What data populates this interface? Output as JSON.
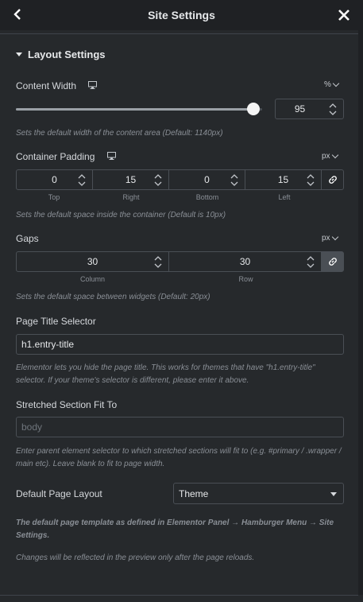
{
  "header": {
    "title": "Site Settings",
    "back_icon": "chevron-left-icon",
    "close_icon": "close-icon"
  },
  "section": {
    "title": "Layout Settings"
  },
  "content_width": {
    "label": "Content Width",
    "unit": "%",
    "value": "95",
    "slider_fraction": 0.95,
    "hint": "Sets the default width of the content area (Default: 1140px)"
  },
  "container_padding": {
    "label": "Container Padding",
    "unit": "px",
    "fields": [
      {
        "value": "0",
        "label": "Top"
      },
      {
        "value": "15",
        "label": "Right"
      },
      {
        "value": "0",
        "label": "Bottom"
      },
      {
        "value": "15",
        "label": "Left"
      }
    ],
    "linked": false,
    "hint": "Sets the default space inside the container (Default is 10px)"
  },
  "gaps": {
    "label": "Gaps",
    "unit": "px",
    "fields": [
      {
        "value": "30",
        "label": "Column"
      },
      {
        "value": "30",
        "label": "Row"
      }
    ],
    "linked": true,
    "hint": "Sets the default space between widgets (Default: 20px)"
  },
  "page_title_selector": {
    "label": "Page Title Selector",
    "value": "h1.entry-title",
    "hint": "Elementor lets you hide the page title. This works for themes that have \"h1.entry-title\" selector. If your theme's selector is different, please enter it above."
  },
  "stretched_section": {
    "label": "Stretched Section Fit To",
    "placeholder": "body",
    "hint": "Enter parent element selector to which stretched sections will fit to (e.g. #primary / .wrapper / main etc). Leave blank to fit to page width."
  },
  "default_page_layout": {
    "label": "Default Page Layout",
    "value": "Theme",
    "hint": "The default page template as defined in Elementor Panel → Hamburger Menu → Site Settings.",
    "reload_hint": "Changes will be reflected in the preview only after the page reloads."
  }
}
